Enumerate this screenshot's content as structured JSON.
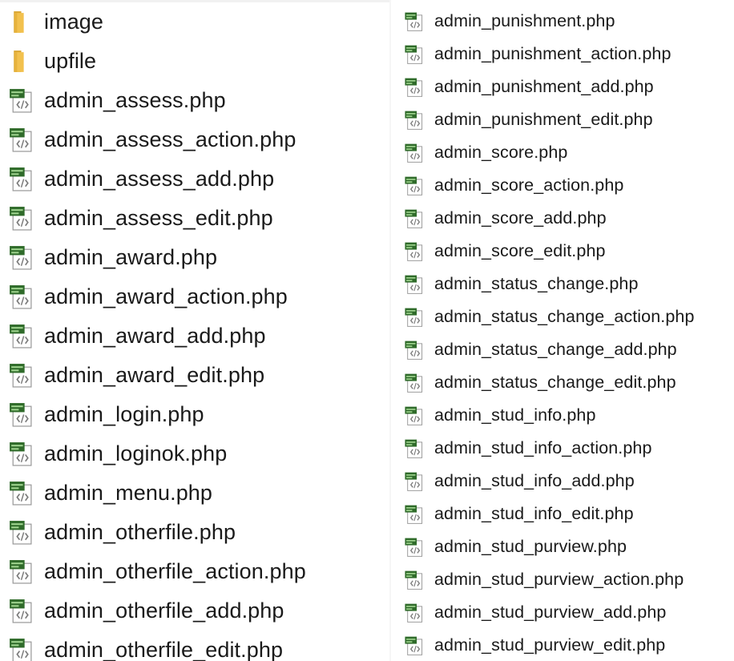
{
  "left_column": [
    {
      "name": "image",
      "type": "folder",
      "icon": "folder-icon"
    },
    {
      "name": "upfile",
      "type": "folder",
      "icon": "folder-icon"
    },
    {
      "name": "admin_assess.php",
      "type": "php",
      "icon": "php-file-icon"
    },
    {
      "name": "admin_assess_action.php",
      "type": "php",
      "icon": "php-file-icon"
    },
    {
      "name": "admin_assess_add.php",
      "type": "php",
      "icon": "php-file-icon"
    },
    {
      "name": "admin_assess_edit.php",
      "type": "php",
      "icon": "php-file-icon"
    },
    {
      "name": "admin_award.php",
      "type": "php",
      "icon": "php-file-icon"
    },
    {
      "name": "admin_award_action.php",
      "type": "php",
      "icon": "php-file-icon"
    },
    {
      "name": "admin_award_add.php",
      "type": "php",
      "icon": "php-file-icon"
    },
    {
      "name": "admin_award_edit.php",
      "type": "php",
      "icon": "php-file-icon"
    },
    {
      "name": "admin_login.php",
      "type": "php",
      "icon": "php-file-icon"
    },
    {
      "name": "admin_loginok.php",
      "type": "php",
      "icon": "php-file-icon"
    },
    {
      "name": "admin_menu.php",
      "type": "php",
      "icon": "php-file-icon"
    },
    {
      "name": "admin_otherfile.php",
      "type": "php",
      "icon": "php-file-icon"
    },
    {
      "name": "admin_otherfile_action.php",
      "type": "php",
      "icon": "php-file-icon"
    },
    {
      "name": "admin_otherfile_add.php",
      "type": "php",
      "icon": "php-file-icon"
    },
    {
      "name": "admin_otherfile_edit.php",
      "type": "php",
      "icon": "php-file-icon"
    }
  ],
  "right_column": [
    {
      "name": "admin_punishment.php",
      "type": "php",
      "icon": "php-file-icon"
    },
    {
      "name": "admin_punishment_action.php",
      "type": "php",
      "icon": "php-file-icon"
    },
    {
      "name": "admin_punishment_add.php",
      "type": "php",
      "icon": "php-file-icon"
    },
    {
      "name": "admin_punishment_edit.php",
      "type": "php",
      "icon": "php-file-icon"
    },
    {
      "name": "admin_score.php",
      "type": "php",
      "icon": "php-file-icon"
    },
    {
      "name": "admin_score_action.php",
      "type": "php",
      "icon": "php-file-icon"
    },
    {
      "name": "admin_score_add.php",
      "type": "php",
      "icon": "php-file-icon"
    },
    {
      "name": "admin_score_edit.php",
      "type": "php",
      "icon": "php-file-icon"
    },
    {
      "name": "admin_status_change.php",
      "type": "php",
      "icon": "php-file-icon"
    },
    {
      "name": "admin_status_change_action.php",
      "type": "php",
      "icon": "php-file-icon"
    },
    {
      "name": "admin_status_change_add.php",
      "type": "php",
      "icon": "php-file-icon"
    },
    {
      "name": "admin_status_change_edit.php",
      "type": "php",
      "icon": "php-file-icon"
    },
    {
      "name": "admin_stud_info.php",
      "type": "php",
      "icon": "php-file-icon"
    },
    {
      "name": "admin_stud_info_action.php",
      "type": "php",
      "icon": "php-file-icon"
    },
    {
      "name": "admin_stud_info_add.php",
      "type": "php",
      "icon": "php-file-icon"
    },
    {
      "name": "admin_stud_info_edit.php",
      "type": "php",
      "icon": "php-file-icon"
    },
    {
      "name": "admin_stud_purview.php",
      "type": "php",
      "icon": "php-file-icon"
    },
    {
      "name": "admin_stud_purview_action.php",
      "type": "php",
      "icon": "php-file-icon"
    },
    {
      "name": "admin_stud_purview_add.php",
      "type": "php",
      "icon": "php-file-icon"
    },
    {
      "name": "admin_stud_purview_edit.php",
      "type": "php",
      "icon": "php-file-icon"
    }
  ],
  "colors": {
    "folder": "#f2c14e",
    "folder_dark": "#d9a530",
    "php_badge": "#2f6b2a",
    "text": "#1a1a1a"
  }
}
